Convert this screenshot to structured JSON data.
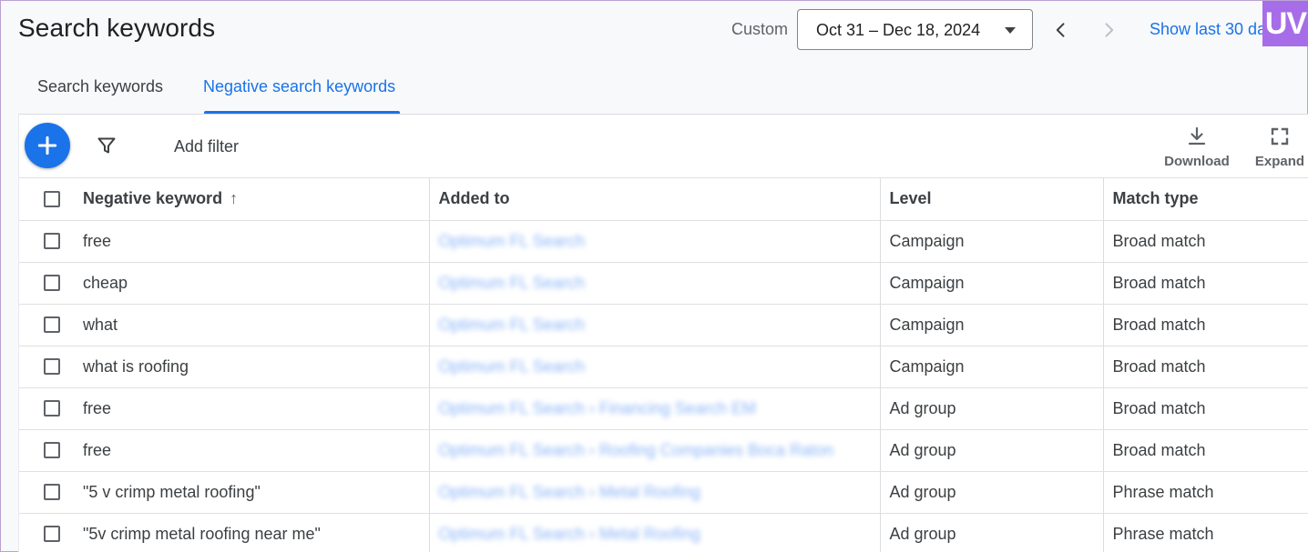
{
  "header": {
    "title": "Search keywords",
    "custom_label": "Custom",
    "date_range": "Oct 31 – Dec 18, 2024",
    "show_last": "Show last 30 da",
    "logo_text": "UV"
  },
  "tabs": [
    {
      "label": "Search keywords",
      "active": false
    },
    {
      "label": "Negative search keywords",
      "active": true
    }
  ],
  "toolbar": {
    "add_filter": "Add filter",
    "download_label": "Download",
    "expand_label": "Expand"
  },
  "table": {
    "columns": [
      "Negative keyword",
      "Added to",
      "Level",
      "Match type"
    ],
    "sort_indicator": "↑",
    "rows": [
      {
        "keyword": "free",
        "added_to": "Optimum FL Search",
        "level": "Campaign",
        "match_type": "Broad match"
      },
      {
        "keyword": "cheap",
        "added_to": "Optimum FL Search",
        "level": "Campaign",
        "match_type": "Broad match"
      },
      {
        "keyword": "what",
        "added_to": "Optimum FL Search",
        "level": "Campaign",
        "match_type": "Broad match"
      },
      {
        "keyword": "what is roofing",
        "added_to": "Optimum FL Search",
        "level": "Campaign",
        "match_type": "Broad match"
      },
      {
        "keyword": "free",
        "added_to": "Optimum FL Search › Financing Search EM",
        "level": "Ad group",
        "match_type": "Broad match"
      },
      {
        "keyword": "free",
        "added_to": "Optimum FL Search › Roofing Companies Boca Raton",
        "level": "Ad group",
        "match_type": "Broad match"
      },
      {
        "keyword": "\"5 v crimp metal roofing\"",
        "added_to": "Optimum FL Search › Metal Roofing",
        "level": "Ad group",
        "match_type": "Phrase match"
      },
      {
        "keyword": "\"5v crimp metal roofing near me\"",
        "added_to": "Optimum FL Search › Metal Roofing",
        "level": "Ad group",
        "match_type": "Phrase match"
      }
    ]
  },
  "colors": {
    "accent": "#1a73e8",
    "logo_bg": "#a76de8",
    "background": "#f8f9fa"
  }
}
